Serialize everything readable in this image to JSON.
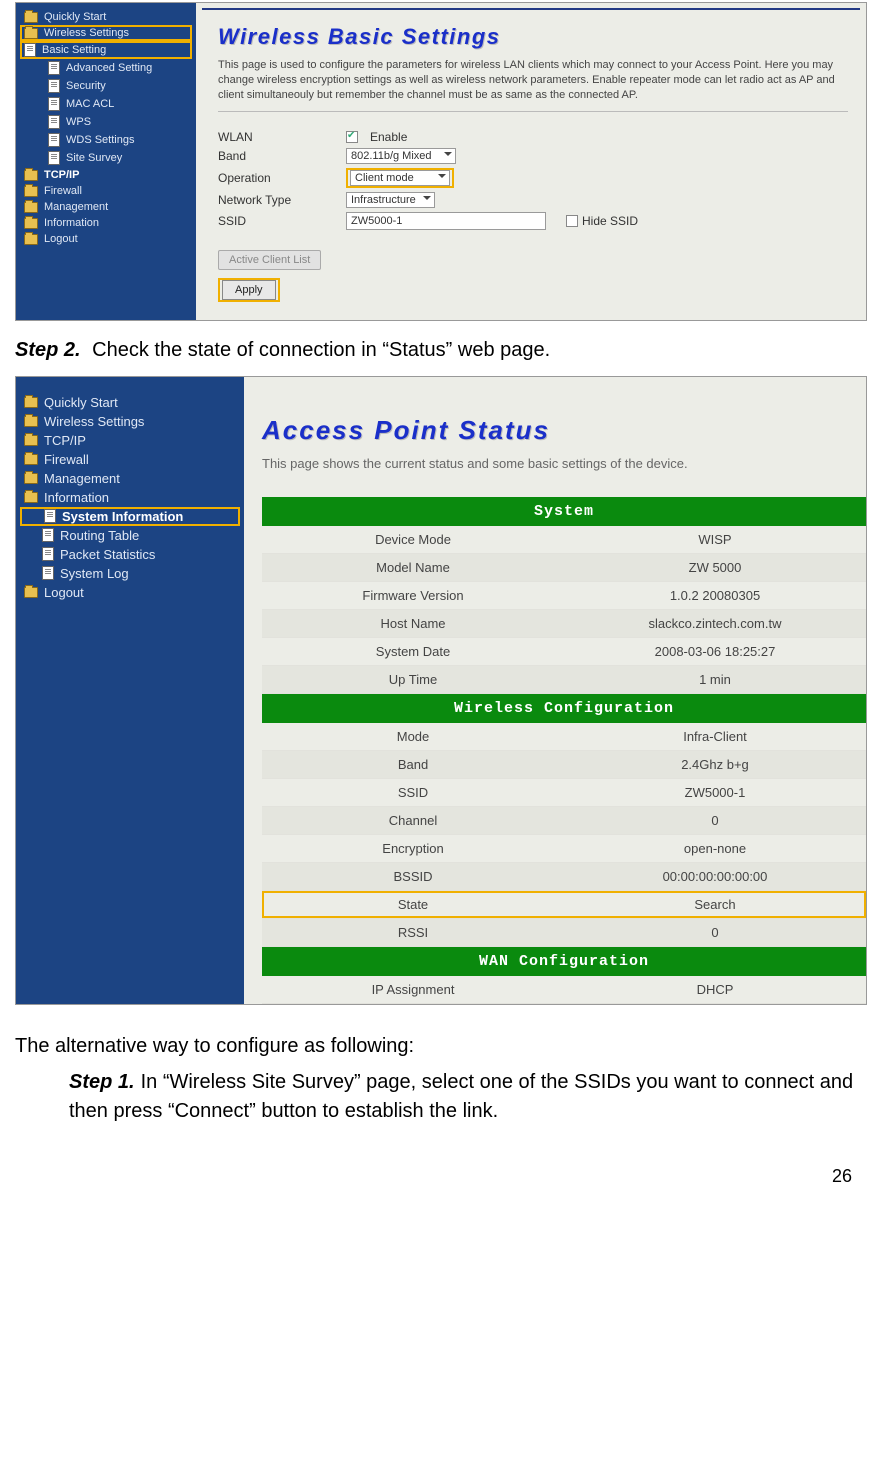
{
  "screenshot1": {
    "nav": {
      "quickly_start": "Quickly Start",
      "wireless_settings": "Wireless Settings",
      "basic_setting": "Basic Setting",
      "advanced_setting": "Advanced Setting",
      "security": "Security",
      "mac_acl": "MAC ACL",
      "wps": "WPS",
      "wds_settings": "WDS Settings",
      "site_survey": "Site Survey",
      "tcpip": "TCP/IP",
      "firewall": "Firewall",
      "management": "Management",
      "information": "Information",
      "logout": "Logout"
    },
    "title": "Wireless Basic Settings",
    "desc": "This page is used to configure the parameters for wireless LAN clients which may connect to your Access Point. Here you may change wireless encryption settings as well as wireless network parameters. Enable repeater mode can let radio act as AP and client simultaneouly but remember the channel must be as same as the connected AP.",
    "form": {
      "wlan_label": "WLAN",
      "wlan_enable": "Enable",
      "band_label": "Band",
      "band_value": "802.11b/g Mixed",
      "operation_label": "Operation",
      "operation_value": "Client mode",
      "network_type_label": "Network Type",
      "network_type_value": "Infrastructure",
      "ssid_label": "SSID",
      "ssid_value": "ZW5000-1",
      "hide_ssid": "Hide SSID",
      "active_client_list": "Active Client List",
      "apply": "Apply"
    }
  },
  "step2_label": "Step 2.",
  "step2_text": "Check the state of connection in “Status” web page.",
  "screenshot2": {
    "nav": {
      "quickly_start": "Quickly Start",
      "wireless_settings": "Wireless Settings",
      "tcpip": "TCP/IP",
      "firewall": "Firewall",
      "management": "Management",
      "information": "Information",
      "system_information": "System Information",
      "routing_table": "Routing Table",
      "packet_statistics": "Packet Statistics",
      "system_log": "System Log",
      "logout": "Logout"
    },
    "title": "Access Point Status",
    "desc": "This page shows the current status and some basic settings of the device.",
    "sections": {
      "system": "System",
      "wireless": "Wireless Configuration",
      "wan": "WAN Configuration"
    },
    "system_rows": [
      {
        "k": "Device Mode",
        "v": "WISP"
      },
      {
        "k": "Model Name",
        "v": "ZW 5000"
      },
      {
        "k": "Firmware Version",
        "v": "1.0.2 20080305"
      },
      {
        "k": "Host Name",
        "v": "slackco.zintech.com.tw"
      },
      {
        "k": "System Date",
        "v": "2008-03-06 18:25:27"
      },
      {
        "k": "Up Time",
        "v": "1 min"
      }
    ],
    "wireless_rows": [
      {
        "k": "Mode",
        "v": "Infra-Client"
      },
      {
        "k": "Band",
        "v": "2.4Ghz b+g"
      },
      {
        "k": "SSID",
        "v": "ZW5000-1"
      },
      {
        "k": "Channel",
        "v": "0"
      },
      {
        "k": "Encryption",
        "v": "open-none"
      },
      {
        "k": "BSSID",
        "v": "00:00:00:00:00:00"
      },
      {
        "k": "State",
        "v": "Search"
      },
      {
        "k": "RSSI",
        "v": "0"
      }
    ],
    "wan_rows": [
      {
        "k": "IP Assignment",
        "v": "DHCP"
      }
    ]
  },
  "alt_text": "The alternative way to configure as following:",
  "step1_label": "Step 1.",
  "step1_text": "In “Wireless Site Survey” page, select one of the SSIDs you want to connect and then press “Connect” button to establish the link.",
  "page_number": "26"
}
